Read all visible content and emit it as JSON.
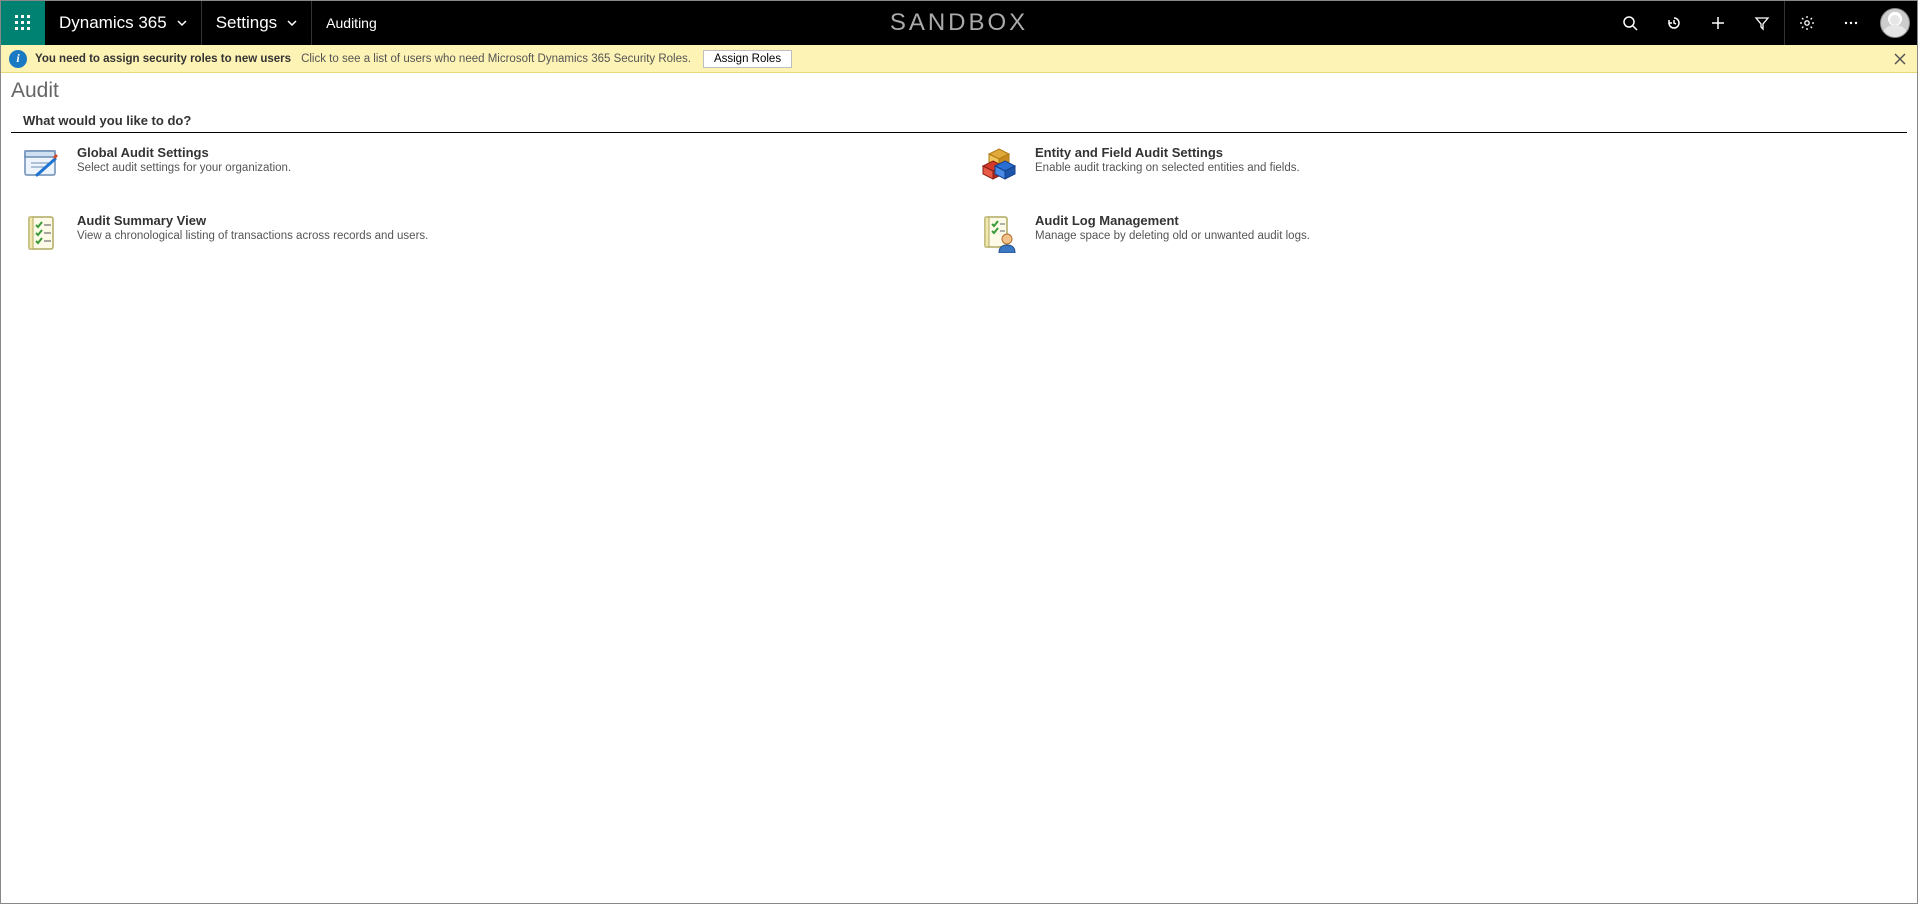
{
  "nav": {
    "product": "Dynamics 365",
    "area": "Settings",
    "breadcrumb": "Auditing",
    "environment_label": "SANDBOX"
  },
  "notice": {
    "bold": "You need to assign security roles to new users",
    "text": "Click to see a list of users who need Microsoft Dynamics 365 Security Roles.",
    "button": "Assign Roles"
  },
  "page": {
    "title": "Audit",
    "prompt": "What would you like to do?"
  },
  "cards": [
    {
      "title": "Global Audit Settings",
      "desc": "Select audit settings for your organization.",
      "icon": "settings-doc-icon"
    },
    {
      "title": "Entity and Field Audit Settings",
      "desc": "Enable audit tracking on selected entities and fields.",
      "icon": "cubes-icon"
    },
    {
      "title": "Audit Summary View",
      "desc": "View a chronological listing of transactions across records and users.",
      "icon": "checklist-icon"
    },
    {
      "title": "Audit Log Management",
      "desc": "Manage space by deleting old or unwanted audit logs.",
      "icon": "log-user-icon"
    }
  ]
}
